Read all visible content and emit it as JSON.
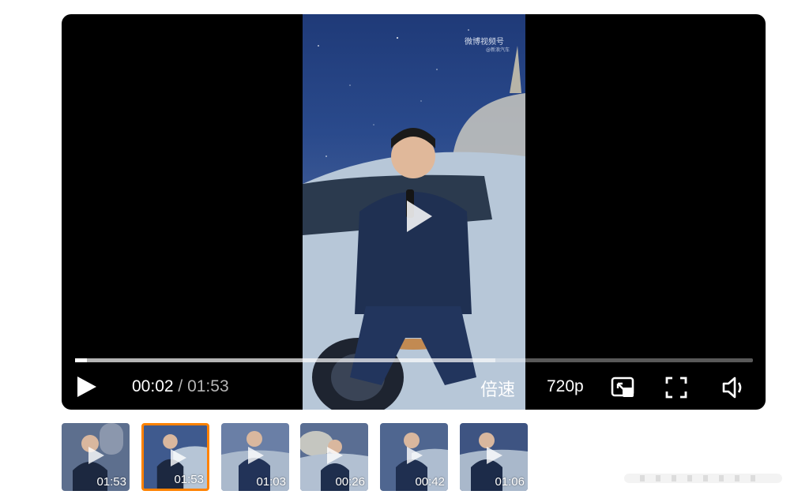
{
  "player": {
    "watermark": "微博视频号",
    "watermark_sub": "@新浪汽车",
    "progress": {
      "played_fraction": 0.018,
      "buffered_fraction": 0.62
    },
    "time": {
      "current": "00:02",
      "separator": " / ",
      "duration": "01:53"
    },
    "controls": {
      "speed_label": "倍速",
      "quality_label": "720p",
      "play_icon": "play-icon",
      "pip_icon": "picture-in-picture-icon",
      "fullscreen_icon": "fullscreen-icon",
      "volume_icon": "volume-icon"
    },
    "center_icon": "play-icon"
  },
  "playlist": {
    "items": [
      {
        "duration": "01:53",
        "active": false
      },
      {
        "duration": "01:53",
        "active": true
      },
      {
        "duration": "01:03",
        "active": false
      },
      {
        "duration": "00:26",
        "active": false
      },
      {
        "duration": "00:42",
        "active": false
      },
      {
        "duration": "01:06",
        "active": false
      }
    ]
  },
  "colors": {
    "accent": "#ff8200",
    "player_bg": "#000000"
  }
}
